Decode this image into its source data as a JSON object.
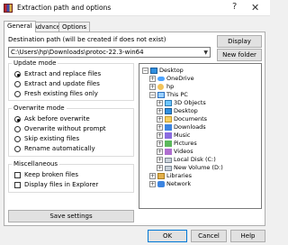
{
  "window": {
    "title": "Extraction path and options",
    "help_glyph": "?",
    "close_glyph": "✕"
  },
  "tabs": [
    {
      "label": "General",
      "active": true
    },
    {
      "label": "Advanced",
      "active": false
    },
    {
      "label": "Options",
      "active": false
    }
  ],
  "destination": {
    "label": "Destination path (will be created if does not exist)",
    "value": "C:\\Users\\hp\\Downloads\\protoc-22.3-win64",
    "display_button": "Display",
    "new_folder_button": "New folder"
  },
  "update_mode": {
    "title": "Update mode",
    "options": [
      {
        "label": "Extract and replace files",
        "selected": true
      },
      {
        "label": "Extract and update files",
        "selected": false
      },
      {
        "label": "Fresh existing files only",
        "selected": false
      }
    ]
  },
  "overwrite_mode": {
    "title": "Overwrite mode",
    "options": [
      {
        "label": "Ask before overwrite",
        "selected": true
      },
      {
        "label": "Overwrite without prompt",
        "selected": false
      },
      {
        "label": "Skip existing files",
        "selected": false
      },
      {
        "label": "Rename automatically",
        "selected": false
      }
    ]
  },
  "misc": {
    "title": "Miscellaneous",
    "options": [
      {
        "label": "Keep broken files",
        "checked": false
      },
      {
        "label": "Display files in Explorer",
        "checked": false
      }
    ]
  },
  "save_settings_button": "Save settings",
  "tree": {
    "nodes": [
      {
        "label": "Desktop",
        "icon": "desktop-icon",
        "expander": "−"
      },
      {
        "label": "OneDrive",
        "icon": "cloud-icon",
        "expander": "+"
      },
      {
        "label": "hp",
        "icon": "user-icon",
        "expander": "+"
      },
      {
        "label": "This PC",
        "icon": "computer-icon",
        "expander": "−"
      },
      {
        "label": "3D Objects",
        "icon": "3d-objects-icon",
        "expander": "+"
      },
      {
        "label": "Desktop",
        "icon": "desktop-folder-icon",
        "expander": "+"
      },
      {
        "label": "Documents",
        "icon": "documents-icon",
        "expander": "+"
      },
      {
        "label": "Downloads",
        "icon": "downloads-icon",
        "expander": "+"
      },
      {
        "label": "Music",
        "icon": "music-icon",
        "expander": "+"
      },
      {
        "label": "Pictures",
        "icon": "pictures-icon",
        "expander": "+"
      },
      {
        "label": "Videos",
        "icon": "videos-icon",
        "expander": "+"
      },
      {
        "label": "Local Disk (C:)",
        "icon": "drive-icon",
        "expander": "+"
      },
      {
        "label": "New Volume (D:)",
        "icon": "drive-icon",
        "expander": "+"
      },
      {
        "label": "Libraries",
        "icon": "libraries-icon",
        "expander": "+"
      },
      {
        "label": "Network",
        "icon": "network-icon",
        "expander": "+"
      }
    ]
  },
  "footer": {
    "ok": "OK",
    "cancel": "Cancel",
    "help": "Help"
  },
  "colors": {
    "accent": "#0078d7",
    "panel": "#ffffff",
    "face": "#f0f0f0"
  }
}
